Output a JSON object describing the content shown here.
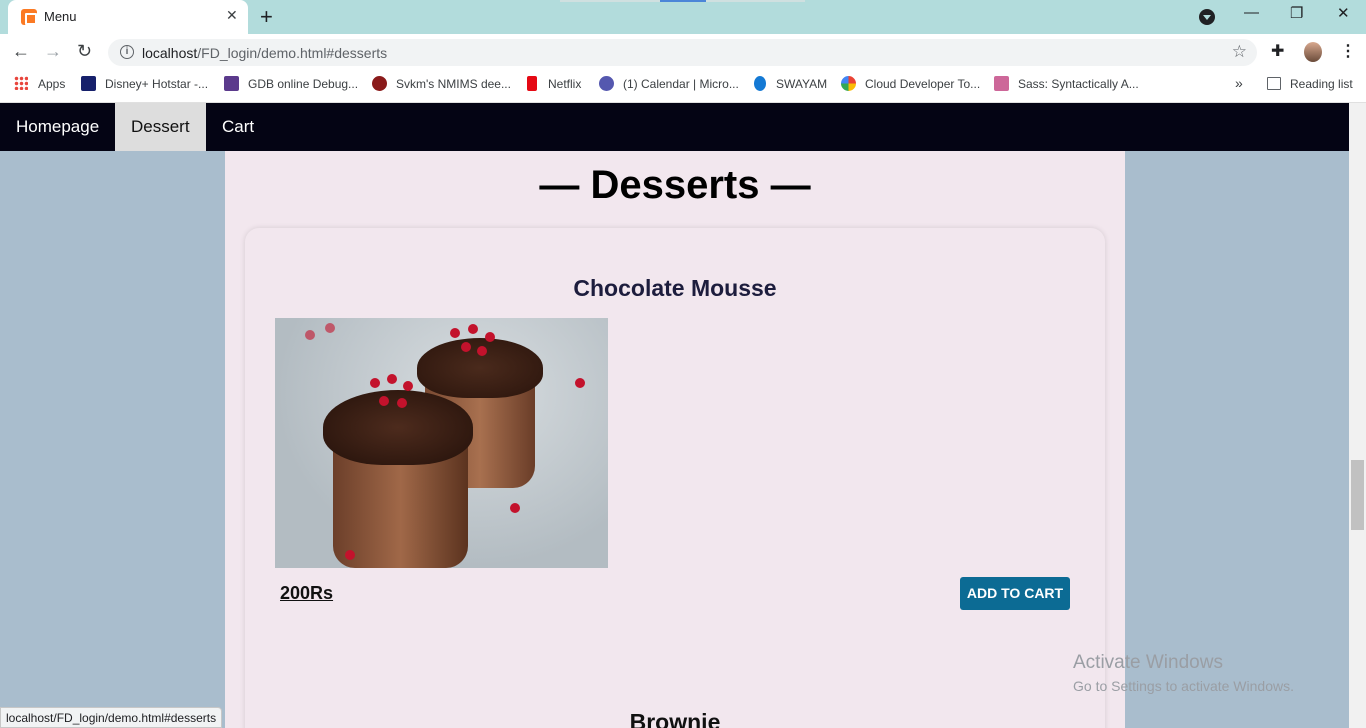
{
  "browser": {
    "tab_title": "Menu",
    "tab_close": "✕",
    "new_tab": "+",
    "url_host": "localhost",
    "url_path": "/FD_login/demo.html#desserts",
    "window_controls": {
      "minimize": "—",
      "restore": "❐",
      "close": "✕"
    },
    "bookmarks": [
      {
        "label": "Apps",
        "icon": "apps-grid-icon"
      },
      {
        "label": "Disney+ Hotstar -...",
        "icon": "hotstar-icon"
      },
      {
        "label": "GDB online Debug...",
        "icon": "gdb-icon"
      },
      {
        "label": "Svkm's NMIMS dee...",
        "icon": "nmims-icon"
      },
      {
        "label": "Netflix",
        "icon": "netflix-icon"
      },
      {
        "label": "(1) Calendar | Micro...",
        "icon": "teams-icon"
      },
      {
        "label": "SWAYAM",
        "icon": "swayam-icon"
      },
      {
        "label": "Cloud Developer To...",
        "icon": "google-cloud-icon"
      },
      {
        "label": "Sass: Syntactically A...",
        "icon": "sass-icon"
      }
    ],
    "more_bookmarks": "»",
    "reading_list": "Reading list",
    "status_url": "localhost/FD_login/demo.html#desserts"
  },
  "nav": {
    "items": [
      {
        "label": "Homepage",
        "active": false
      },
      {
        "label": "Dessert",
        "active": true
      },
      {
        "label": "Cart",
        "active": false
      }
    ]
  },
  "main": {
    "section_title": "— Desserts —",
    "items": [
      {
        "name": "Chocolate Mousse",
        "price": "200Rs",
        "button": "ADD TO CART"
      },
      {
        "name": "Brownie"
      }
    ]
  },
  "watermark": {
    "line1": "Activate Windows",
    "line2": "Go to Settings to activate Windows."
  },
  "colors": {
    "navbar_bg": "#040414",
    "page_bg": "#a9bdcd",
    "content_bg": "#f2e7ee",
    "button_bg": "#0c6b94",
    "tabstrip": "#b2dcdc"
  }
}
